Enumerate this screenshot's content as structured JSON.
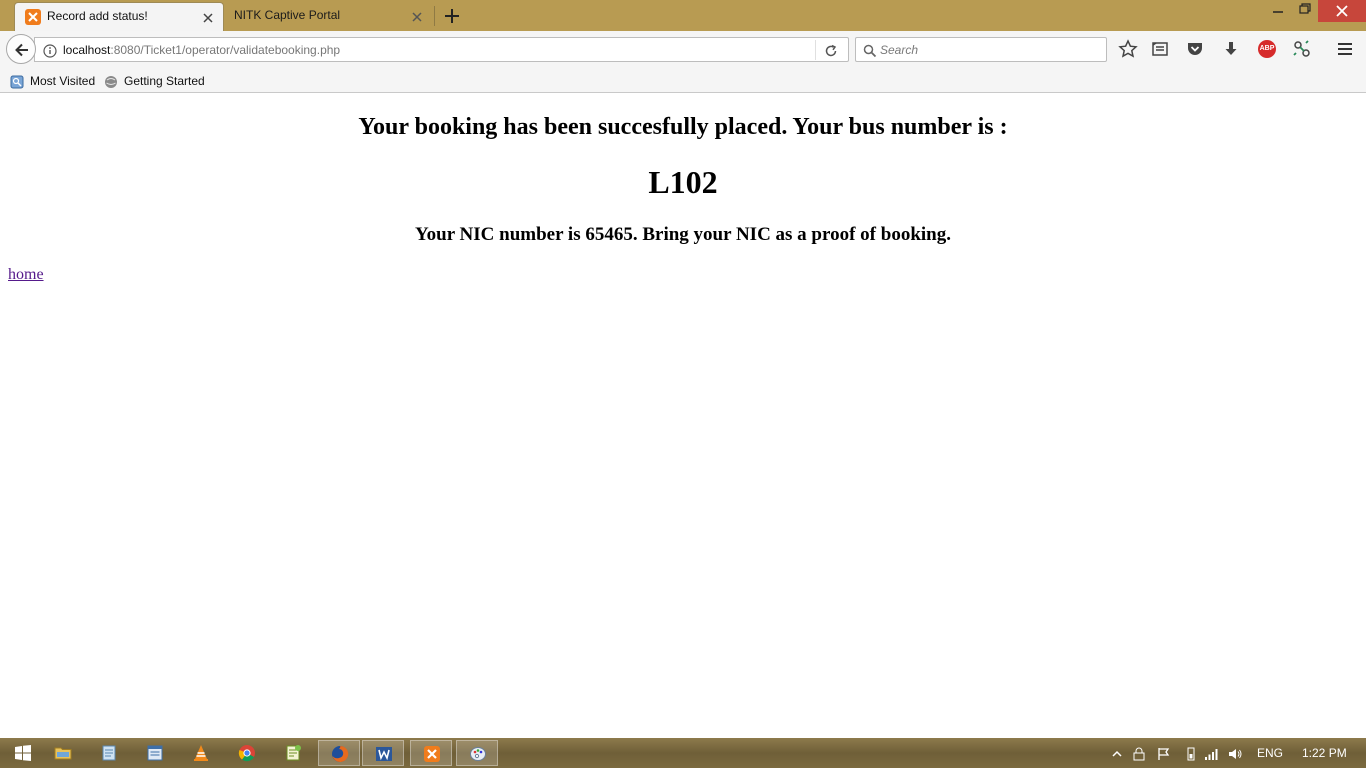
{
  "browser": {
    "tabs": [
      {
        "title": "Record add status!",
        "active": true
      },
      {
        "title": "NITK Captive Portal",
        "active": false
      }
    ],
    "url": {
      "host": "localhost",
      "rest": ":8080/Ticket1/operator/validatebooking.php"
    },
    "search": {
      "placeholder": "Search"
    },
    "toolbar_icons": [
      "bookmark-star-icon",
      "reading-list-icon",
      "pocket-icon",
      "downloads-icon",
      "adblock-plus-icon",
      "extension-icon",
      "hamburger-menu-icon"
    ],
    "adblock_label": "ABP",
    "bookmarks": [
      {
        "label": "Most Visited",
        "icon": "most-visited-icon"
      },
      {
        "label": "Getting Started",
        "icon": "firefox-globe-icon"
      }
    ]
  },
  "page": {
    "heading": "Your booking has been succesfully placed. Your bus number is :",
    "bus_number": "L102",
    "nic_message": "Your NIC number is 65465. Bring your NIC as a proof of booking.",
    "home_link": "home"
  },
  "taskbar": {
    "apps": [
      "windows-start-icon",
      "file-explorer-icon",
      "notepad-icon",
      "window-app-icon",
      "vlc-icon",
      "chrome-icon",
      "notepad-plus-icon",
      "firefox-icon",
      "word-icon",
      "xampp-icon",
      "paint-icon"
    ],
    "language": "ENG",
    "time": "1:22 PM"
  },
  "colors": {
    "titlebar": "#b89b52",
    "link_visited": "#551a8b",
    "close_button": "#c7463b"
  }
}
